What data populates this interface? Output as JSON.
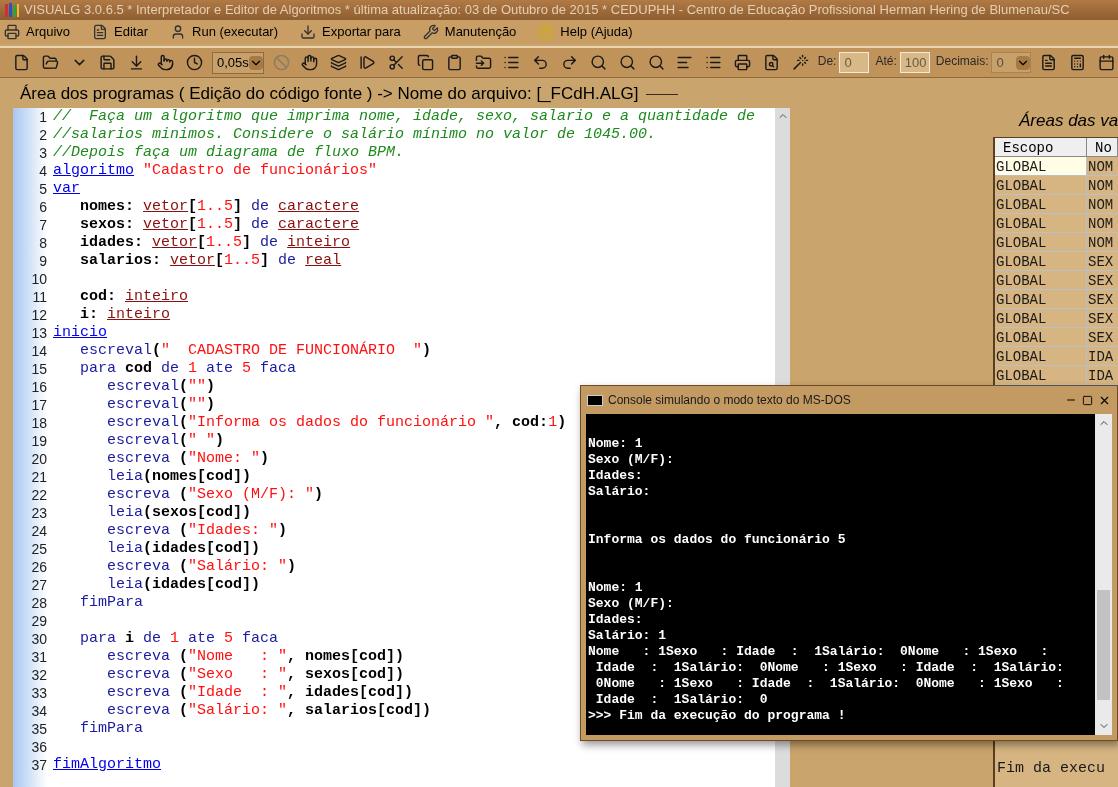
{
  "window": {
    "title": "VISUALG 3.0.6.5 * Interpretador e Editor de Algoritmos * última atualização: 03 de Outubro de 2015 * CEDUPHH - Centro de Educação Profissional Herman Hering de Blumenau/SC"
  },
  "menu": [
    "Arquivo",
    "Editar",
    "Run (executar)",
    "Exportar para",
    "Manutenção",
    "Help (Ajuda)"
  ],
  "toolbar": {
    "speed": {
      "value": "0,05s"
    },
    "range_fields": [
      {
        "label": "De:",
        "value": "0",
        "disabled": true
      },
      {
        "label": "Até:",
        "value": "100",
        "disabled": true
      }
    ],
    "decimals": {
      "label": "Decimais:",
      "value": "0",
      "disabled": true
    }
  },
  "editor": {
    "title": "Área dos programas ( Edição do código fonte ) -> Nome do arquivo: [_FCdH.ALG]",
    "lines": [
      {
        "n": "1",
        "tokens": [
          {
            "kind": "comment",
            "text": "//  Faça um algoritmo que imprima nome, idade, sexo, salario e a quantidade de"
          }
        ]
      },
      {
        "n": "2",
        "tokens": [
          {
            "kind": "comment",
            "text": "//salarios minimos. Considere o salário mínimo no valor de 1045.00."
          }
        ]
      },
      {
        "n": "3",
        "tokens": [
          {
            "kind": "comment",
            "text": "//Depois faça um diagrama de fluxo BPM."
          }
        ]
      },
      {
        "n": "4",
        "tokens": [
          {
            "kind": "keyword",
            "text": "algoritmo"
          },
          {
            "kind": "string",
            "text": " \"Cadastro de funcionários\""
          }
        ]
      },
      {
        "n": "5",
        "tokens": [
          {
            "kind": "keyword",
            "text": "var"
          }
        ]
      },
      {
        "n": "6",
        "tokens": [
          {
            "kind": "plain",
            "text": "   nomes: "
          },
          {
            "kind": "type",
            "text": "vetor"
          },
          {
            "kind": "plain",
            "text": "["
          },
          {
            "kind": "number",
            "text": "1..5"
          },
          {
            "kind": "plain",
            "text": "]"
          },
          {
            "kind": "builtin",
            "text": " de "
          },
          {
            "kind": "type",
            "text": "caractere"
          }
        ]
      },
      {
        "n": "7",
        "tokens": [
          {
            "kind": "plain",
            "text": "   sexos: "
          },
          {
            "kind": "type",
            "text": "vetor"
          },
          {
            "kind": "plain",
            "text": "["
          },
          {
            "kind": "number",
            "text": "1..5"
          },
          {
            "kind": "plain",
            "text": "]"
          },
          {
            "kind": "builtin",
            "text": " de "
          },
          {
            "kind": "type",
            "text": "caractere"
          }
        ]
      },
      {
        "n": "8",
        "tokens": [
          {
            "kind": "plain",
            "text": "   idades: "
          },
          {
            "kind": "type",
            "text": "vetor"
          },
          {
            "kind": "plain",
            "text": "["
          },
          {
            "kind": "number",
            "text": "1..5"
          },
          {
            "kind": "plain",
            "text": "]"
          },
          {
            "kind": "builtin",
            "text": " de "
          },
          {
            "kind": "type",
            "text": "inteiro"
          }
        ]
      },
      {
        "n": "9",
        "tokens": [
          {
            "kind": "plain",
            "text": "   salarios: "
          },
          {
            "kind": "type",
            "text": "vetor"
          },
          {
            "kind": "plain",
            "text": "["
          },
          {
            "kind": "number",
            "text": "1..5"
          },
          {
            "kind": "plain",
            "text": "]"
          },
          {
            "kind": "builtin",
            "text": " de "
          },
          {
            "kind": "type",
            "text": "real"
          }
        ]
      },
      {
        "n": "10"
      },
      {
        "n": "11",
        "tokens": [
          {
            "kind": "plain",
            "text": "   cod: "
          },
          {
            "kind": "type",
            "text": "inteiro"
          }
        ]
      },
      {
        "n": "12",
        "tokens": [
          {
            "kind": "plain",
            "text": "   i: "
          },
          {
            "kind": "type",
            "text": "inteiro"
          }
        ]
      },
      {
        "n": "13",
        "tokens": [
          {
            "kind": "keyword",
            "text": "inicio"
          }
        ]
      },
      {
        "n": "14",
        "tokens": [
          {
            "kind": "builtin",
            "text": "   escreval"
          },
          {
            "kind": "plain",
            "text": "("
          },
          {
            "kind": "string",
            "text": "\"  CADASTRO DE FUNCIONÁRIO  \""
          },
          {
            "kind": "plain",
            "text": ")"
          }
        ]
      },
      {
        "n": "15",
        "tokens": [
          {
            "kind": "builtin",
            "text": "   para"
          },
          {
            "kind": "plain",
            "text": " cod "
          },
          {
            "kind": "builtin",
            "text": "de "
          },
          {
            "kind": "number",
            "text": "1"
          },
          {
            "kind": "builtin",
            "text": " ate "
          },
          {
            "kind": "number",
            "text": "5"
          },
          {
            "kind": "builtin",
            "text": " faca"
          }
        ]
      },
      {
        "n": "16",
        "tokens": [
          {
            "kind": "builtin",
            "text": "      escreval"
          },
          {
            "kind": "plain",
            "text": "("
          },
          {
            "kind": "string",
            "text": "\"\""
          },
          {
            "kind": "plain",
            "text": ")"
          }
        ]
      },
      {
        "n": "17",
        "tokens": [
          {
            "kind": "builtin",
            "text": "      escreval"
          },
          {
            "kind": "plain",
            "text": "("
          },
          {
            "kind": "string",
            "text": "\"\""
          },
          {
            "kind": "plain",
            "text": ")"
          }
        ]
      },
      {
        "n": "18",
        "tokens": [
          {
            "kind": "builtin",
            "text": "      escreval"
          },
          {
            "kind": "plain",
            "text": "("
          },
          {
            "kind": "string",
            "text": "\"Informa os dados do funcionário \""
          },
          {
            "kind": "plain",
            "text": ", cod:"
          },
          {
            "kind": "number",
            "text": "1"
          },
          {
            "kind": "plain",
            "text": ")"
          }
        ]
      },
      {
        "n": "19",
        "tokens": [
          {
            "kind": "builtin",
            "text": "      escreval"
          },
          {
            "kind": "plain",
            "text": "("
          },
          {
            "kind": "string",
            "text": "\" \""
          },
          {
            "kind": "plain",
            "text": ")"
          }
        ]
      },
      {
        "n": "20",
        "tokens": [
          {
            "kind": "builtin",
            "text": "      escreva"
          },
          {
            "kind": "plain",
            "text": " ("
          },
          {
            "kind": "string",
            "text": "\"Nome: \""
          },
          {
            "kind": "plain",
            "text": ")"
          }
        ]
      },
      {
        "n": "21",
        "tokens": [
          {
            "kind": "builtin",
            "text": "      leia"
          },
          {
            "kind": "plain",
            "text": "(nomes[cod])"
          }
        ]
      },
      {
        "n": "22",
        "tokens": [
          {
            "kind": "builtin",
            "text": "      escreva"
          },
          {
            "kind": "plain",
            "text": " ("
          },
          {
            "kind": "string",
            "text": "\"Sexo (M/F): \""
          },
          {
            "kind": "plain",
            "text": ")"
          }
        ]
      },
      {
        "n": "23",
        "tokens": [
          {
            "kind": "builtin",
            "text": "      leia"
          },
          {
            "kind": "plain",
            "text": "(sexos[cod])"
          }
        ]
      },
      {
        "n": "24",
        "tokens": [
          {
            "kind": "builtin",
            "text": "      escreva"
          },
          {
            "kind": "plain",
            "text": " ("
          },
          {
            "kind": "string",
            "text": "\"Idades: \""
          },
          {
            "kind": "plain",
            "text": ")"
          }
        ]
      },
      {
        "n": "25",
        "tokens": [
          {
            "kind": "builtin",
            "text": "      leia"
          },
          {
            "kind": "plain",
            "text": "(idades[cod])"
          }
        ]
      },
      {
        "n": "26",
        "tokens": [
          {
            "kind": "builtin",
            "text": "      escreva"
          },
          {
            "kind": "plain",
            "text": " ("
          },
          {
            "kind": "string",
            "text": "\"Salário: \""
          },
          {
            "kind": "plain",
            "text": ")"
          }
        ]
      },
      {
        "n": "27",
        "tokens": [
          {
            "kind": "builtin",
            "text": "      leia"
          },
          {
            "kind": "plain",
            "text": "(idades[cod])"
          }
        ]
      },
      {
        "n": "28",
        "tokens": [
          {
            "kind": "builtin",
            "text": "   fimPara"
          }
        ]
      },
      {
        "n": "29"
      },
      {
        "n": "30",
        "tokens": [
          {
            "kind": "builtin",
            "text": "   para"
          },
          {
            "kind": "plain",
            "text": " i "
          },
          {
            "kind": "builtin",
            "text": "de "
          },
          {
            "kind": "number",
            "text": "1"
          },
          {
            "kind": "builtin",
            "text": " ate "
          },
          {
            "kind": "number",
            "text": "5"
          },
          {
            "kind": "builtin",
            "text": " faca"
          }
        ]
      },
      {
        "n": "31",
        "tokens": [
          {
            "kind": "builtin",
            "text": "      escreva"
          },
          {
            "kind": "plain",
            "text": " ("
          },
          {
            "kind": "string",
            "text": "\"Nome   : \""
          },
          {
            "kind": "plain",
            "text": ", nomes[cod])"
          }
        ]
      },
      {
        "n": "32",
        "tokens": [
          {
            "kind": "builtin",
            "text": "      escreva"
          },
          {
            "kind": "plain",
            "text": " ("
          },
          {
            "kind": "string",
            "text": "\"Sexo   : \""
          },
          {
            "kind": "plain",
            "text": ", sexos[cod])"
          }
        ]
      },
      {
        "n": "33",
        "tokens": [
          {
            "kind": "builtin",
            "text": "      escreva"
          },
          {
            "kind": "plain",
            "text": " ("
          },
          {
            "kind": "string",
            "text": "\"Idade  : \""
          },
          {
            "kind": "plain",
            "text": ", idades[cod])"
          }
        ]
      },
      {
        "n": "34",
        "tokens": [
          {
            "kind": "builtin",
            "text": "      escreva"
          },
          {
            "kind": "plain",
            "text": " ("
          },
          {
            "kind": "string",
            "text": "\"Salário: \""
          },
          {
            "kind": "plain",
            "text": ", salarios[cod])"
          }
        ]
      },
      {
        "n": "35",
        "tokens": [
          {
            "kind": "builtin",
            "text": "   fimPara"
          }
        ]
      },
      {
        "n": "36"
      },
      {
        "n": "37",
        "tokens": [
          {
            "kind": "keyword",
            "text": "fimAlgoritmo"
          }
        ]
      }
    ]
  },
  "variables": {
    "title": "Áreas das va",
    "columns": [
      "Escopo",
      "No"
    ],
    "rows": [
      {
        "scope": "GLOBAL",
        "name": "NOM",
        "selected": true
      },
      {
        "scope": "GLOBAL",
        "name": "NOM",
        "selected": false
      },
      {
        "scope": "GLOBAL",
        "name": "NOM",
        "selected": false
      },
      {
        "scope": "GLOBAL",
        "name": "NOM",
        "selected": false
      },
      {
        "scope": "GLOBAL",
        "name": "NOM",
        "selected": false
      },
      {
        "scope": "GLOBAL",
        "name": "SEX",
        "selected": false
      },
      {
        "scope": "GLOBAL",
        "name": "SEX",
        "selected": false
      },
      {
        "scope": "GLOBAL",
        "name": "SEX",
        "selected": false
      },
      {
        "scope": "GLOBAL",
        "name": "SEX",
        "selected": false
      },
      {
        "scope": "GLOBAL",
        "name": "SEX",
        "selected": false
      },
      {
        "scope": "GLOBAL",
        "name": "IDA",
        "selected": false
      },
      {
        "scope": "GLOBAL",
        "name": "IDA",
        "selected": false
      }
    ]
  },
  "output_panel": {
    "text": "Fim da execu"
  },
  "console": {
    "title": "Console simulando o modo texto do MS-DOS",
    "blocks": [
      [
        "Nome: 1",
        "Sexo (M/F):",
        "Idades:",
        "Salário:"
      ],
      [
        "Informa os dados do funcionário 5"
      ],
      [
        "Nome: 1",
        "Sexo (M/F):",
        "Idades:",
        "Salário: 1",
        "Nome   : 1Sexo   : Idade  :  1Salário:  0Nome   : 1Sexo   :",
        " Idade  :  1Salário:  0Nome   : 1Sexo   : Idade  :  1Salário:",
        " 0Nome   : 1Sexo   : Idade  :  1Salário:  0Nome   : 1Sexo   :",
        " Idade  :  1Salário:  0",
        ">>> Fim da execução do programa !"
      ]
    ]
  }
}
